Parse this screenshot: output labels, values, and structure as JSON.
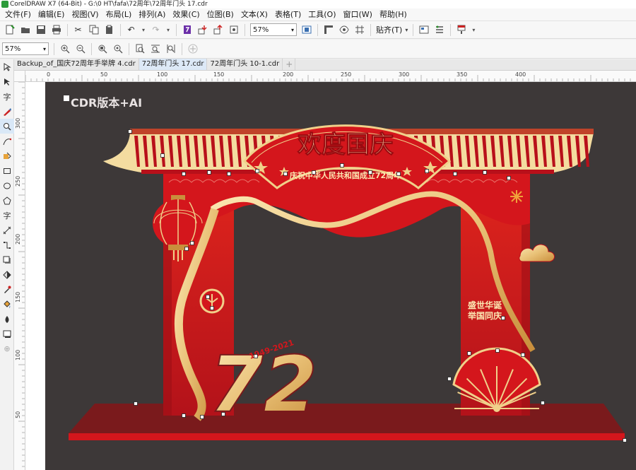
{
  "window": {
    "title": "CorelDRAW X7 (64-Bit) - G:\\0 HT\\fafa\\72周年\\72周年门头 17.cdr"
  },
  "menu": [
    "文件(F)",
    "编辑(E)",
    "视图(V)",
    "布局(L)",
    "排列(A)",
    "效果(C)",
    "位图(B)",
    "文本(X)",
    "表格(T)",
    "工具(O)",
    "窗口(W)",
    "帮助(H)"
  ],
  "toolbar": {
    "zoom_value": "57%",
    "snap_label": "贴齐(T)",
    "zoom_value_2": "57%"
  },
  "tabs": [
    {
      "label": "Backup_of_国庆72周年手举牌 4.cdr"
    },
    {
      "label": "72周年门头 17.cdr"
    },
    {
      "label": "72周年门头 10-1.cdr"
    }
  ],
  "ruler": {
    "h_labels": [
      "0",
      "50",
      "100",
      "150",
      "200",
      "250",
      "300",
      "350",
      "400"
    ],
    "v_labels": [
      "300",
      "250",
      "200",
      "150",
      "100",
      "50"
    ]
  },
  "artwork": {
    "watermark": "CDR版本+AI",
    "title": "欢度国庆",
    "subtitle": "庆祝中华人民共和国成立72周年",
    "years": "1949-2021",
    "number": "72",
    "slogan_line1": "盛世华诞",
    "slogan_line2": "举国同庆"
  },
  "colors": {
    "red": "#d4161c",
    "dark_red": "#a10f14",
    "gold": "#f0d08a",
    "page_bg": "#3d3838"
  }
}
